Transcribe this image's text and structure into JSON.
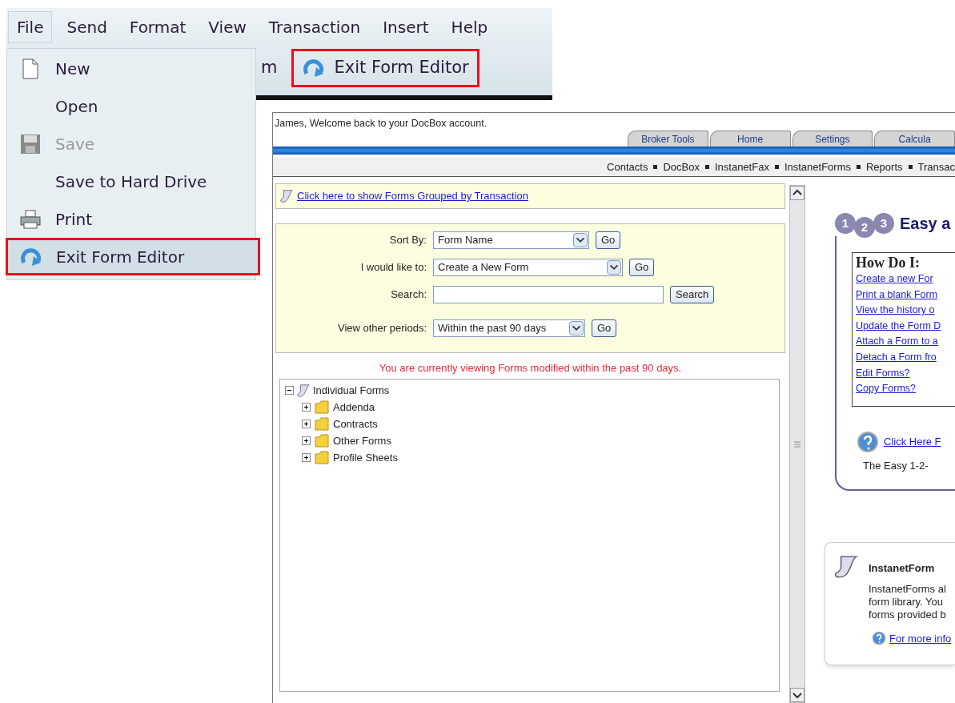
{
  "app_window": {
    "menu_bar": [
      {
        "label": "File",
        "selected": true
      },
      {
        "label": "Send",
        "selected": false
      },
      {
        "label": "Format",
        "selected": false
      },
      {
        "label": "View",
        "selected": false
      },
      {
        "label": "Transaction",
        "selected": false
      },
      {
        "label": "Insert",
        "selected": false
      },
      {
        "label": "Help",
        "selected": false
      }
    ],
    "toolbar": {
      "partial_text": "m",
      "button": {
        "label": "Exit Form Editor",
        "highlighted": true
      }
    }
  },
  "file_menu": {
    "items": [
      {
        "label": "New",
        "kind": "new",
        "disabled": false,
        "highlighted": false
      },
      {
        "label": "Open",
        "kind": "plain",
        "disabled": false,
        "highlighted": false
      },
      {
        "label": "Save",
        "kind": "save",
        "disabled": true,
        "highlighted": false
      },
      {
        "label": "Save to Hard Drive",
        "kind": "plain",
        "disabled": false,
        "highlighted": false
      },
      {
        "label": "Print",
        "kind": "print",
        "disabled": false,
        "highlighted": false
      },
      {
        "label": "Exit Form Editor",
        "kind": "exit",
        "disabled": false,
        "highlighted": true
      }
    ]
  },
  "web_page": {
    "welcome": "James, Welcome back to your DocBox account.",
    "tabs": [
      "Broker Tools",
      "Home",
      "Settings",
      "Calcula"
    ],
    "nav_links": [
      "Contacts",
      "DocBox",
      "InstanetFax",
      "InstanetForms",
      "Reports",
      "Transac"
    ],
    "grouped_link": "Click here to show Forms Grouped by Transaction",
    "form": [
      {
        "kind": "select",
        "label": "Sort By:",
        "value": "Form Name",
        "button": "Go"
      },
      {
        "kind": "select",
        "label": "I would like to:",
        "value": "Create a New Form",
        "button": "Go"
      },
      {
        "kind": "search",
        "label": "Search:",
        "button": "Search"
      },
      {
        "kind": "select",
        "label": "View other periods:",
        "value": "Within the past 90 days",
        "button": "Go"
      }
    ],
    "message": "You are currently viewing Forms modified within the past 90 days.",
    "tree": [
      {
        "label": "Individual Forms",
        "expanded": true,
        "children": [
          {
            "label": "Addenda",
            "expanded": false
          },
          {
            "label": "Contracts",
            "expanded": false
          },
          {
            "label": "Other Forms",
            "expanded": false
          },
          {
            "label": "Profile Sheets",
            "expanded": false
          }
        ]
      }
    ],
    "help_card": {
      "steps": [
        "1",
        "2",
        "3"
      ],
      "title": "Easy a",
      "how_do_i": {
        "title": "How Do I:",
        "links": [
          "Create a new For",
          "Print a blank Form",
          "View the history o",
          "Update the Form D",
          "Attach a Form to a",
          "Detach a Form fro",
          "Edit Forms?",
          "Copy Forms?"
        ]
      },
      "help_link": "Click Here F",
      "caption": "The Easy 1-2-"
    },
    "info_card": {
      "title": "InstanetForm",
      "lines": [
        "InstanetForms al",
        "form library. You",
        "forms provided b"
      ],
      "link": "For more info"
    }
  }
}
